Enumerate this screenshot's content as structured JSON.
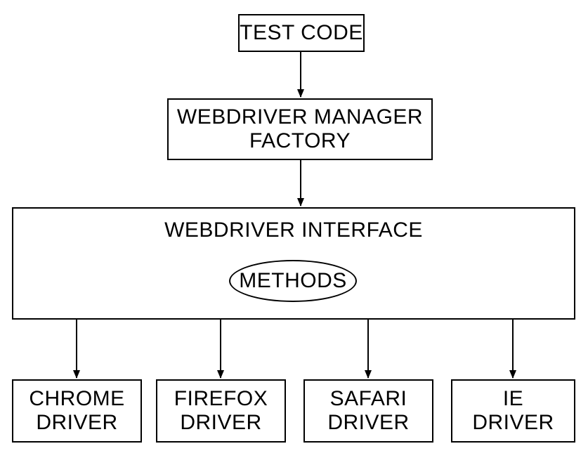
{
  "diagram": {
    "nodes": {
      "test_code": "TEST CODE",
      "factory": "WEBDRIVER MANAGER FACTORY",
      "interface": "WEBDRIVER INTERFACE",
      "methods": "METHODS",
      "chrome": "CHROME DRIVER",
      "firefox": "FIREFOX DRIVER",
      "safari": "SAFARI DRIVER",
      "ie": "IE DRIVER"
    },
    "edges": [
      {
        "from": "test_code",
        "to": "factory"
      },
      {
        "from": "factory",
        "to": "interface"
      },
      {
        "from": "interface",
        "to": "chrome"
      },
      {
        "from": "interface",
        "to": "firefox"
      },
      {
        "from": "interface",
        "to": "safari"
      },
      {
        "from": "interface",
        "to": "ie"
      }
    ]
  }
}
